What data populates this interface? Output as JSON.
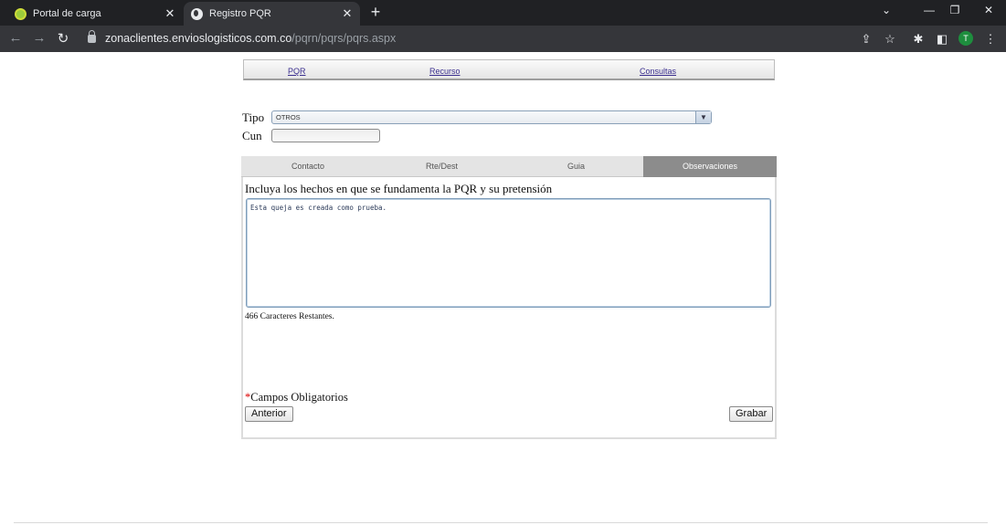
{
  "browser": {
    "tabs": [
      {
        "label": "Portal de carga",
        "active": false
      },
      {
        "label": "Registro PQR",
        "active": true
      }
    ],
    "url_host": "zonaclientes.envioslogisticos.com.co",
    "url_path": "/pqrn/pqrs/pqrs.aspx",
    "profile_initial": "T"
  },
  "menu": {
    "items": [
      "PQR",
      "Recurso",
      "Consultas"
    ]
  },
  "form": {
    "tipo_label": "Tipo",
    "tipo_value": "OTROS",
    "cun_label": "Cun",
    "cun_value": ""
  },
  "panel": {
    "tabs": [
      {
        "label": "Contacto",
        "selected": false
      },
      {
        "label": "Rte/Dest",
        "selected": false
      },
      {
        "label": "Guia",
        "selected": false
      },
      {
        "label": "Observaciones",
        "selected": true
      }
    ],
    "instructions": "Incluya los hechos en que se fundamenta la PQR y su pretensión",
    "observaciones_text": "Esta queja es creada como prueba.",
    "remaining_text": "466 Caracteres Restantes.",
    "required_marker": "*",
    "required_text": "Campos Obligatorios",
    "prev_button": "Anterior",
    "save_button": "Grabar"
  },
  "colors": {
    "chrome_dark": "#202124",
    "chrome_toolbar": "#35363a",
    "selected_tab": "#8c8c8c",
    "link": "#3b2f8f",
    "required": "#dd0000"
  }
}
